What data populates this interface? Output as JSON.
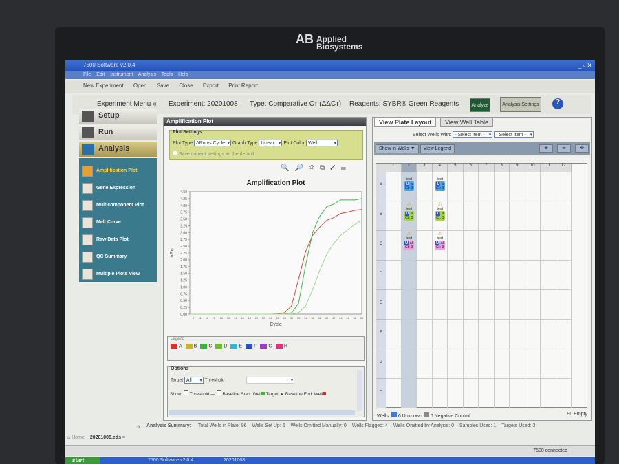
{
  "brand": {
    "logo": "AB",
    "name1": "Applied",
    "name2": "Biosystems"
  },
  "window": {
    "title": "7500 Software v2.0.4",
    "menu": [
      "File",
      "Edit",
      "Instrument",
      "Analysis",
      "Tools",
      "Help"
    ]
  },
  "toolbar": {
    "new_experiment": "New Experiment",
    "open": "Open",
    "save": "Save",
    "close": "Close",
    "export": "Export",
    "print_report": "Print Report"
  },
  "experiment": {
    "menu_title": "Experiment Menu «",
    "experiment": "Experiment: 20201008",
    "type": "Type: Comparative Cт (ΔΔCт)",
    "reagents": "Reagents: SYBR® Green Reagents",
    "analyze": "Analyze",
    "analysis_settings": "Analysis Settings",
    "help": "?"
  },
  "sidebar": {
    "stages": [
      "Setup",
      "Run",
      "Analysis"
    ],
    "items": [
      "Amplification Plot",
      "Gene Expression",
      "Multicomponent Plot",
      "Melt Curve",
      "Raw Data Plot",
      "QC Summary",
      "Multiple Plots View"
    ],
    "collapse": "«"
  },
  "amp": {
    "title": "Amplification Plot",
    "settings_tab": "Plot Settings",
    "plot_type_label": "Plot Type",
    "plot_type": "ΔRn vs Cycle",
    "graph_type_label": "Graph Type",
    "graph_type": "Linear",
    "plot_color_label": "Plot Color",
    "plot_color": "Well",
    "save_default": "Save current settings as the default",
    "legend_title": "Legend",
    "legend": [
      {
        "label": "A",
        "color": "#d9302a"
      },
      {
        "label": "B",
        "color": "#c8b52a"
      },
      {
        "label": "C",
        "color": "#36b53a"
      },
      {
        "label": "D",
        "color": "#6bbf2a"
      },
      {
        "label": "E",
        "color": "#33b6d6"
      },
      {
        "label": "F",
        "color": "#2a4fd0"
      },
      {
        "label": "G",
        "color": "#9a3ad0"
      },
      {
        "label": "H",
        "color": "#e0307a"
      }
    ],
    "options_tab": "Options",
    "target_label": "Target",
    "target": "All",
    "threshold_label": "Threshold",
    "show_label": "Show:",
    "show_threshold": "Threshold",
    "baseline_start": "Baseline Start: Well",
    "target_marker": "Target",
    "baseline_end": "Baseline End: Well"
  },
  "chart_data": {
    "type": "line",
    "title": "Amplification Plot",
    "xlabel": "Cycle",
    "ylabel": "ΔRn",
    "xlim": [
      1,
      50
    ],
    "ylim": [
      0,
      4.5
    ],
    "yticks": [
      "0.00",
      "0.25",
      "0.50",
      "0.75",
      "1.00",
      "1.25",
      "1.50",
      "1.75",
      "2.00",
      "2.25",
      "2.50",
      "2.75",
      "3.00",
      "3.25",
      "3.50",
      "3.75",
      "4.00",
      "4.25",
      "4.50"
    ],
    "x": [
      2,
      4,
      6,
      8,
      10,
      12,
      14,
      16,
      18,
      20,
      22,
      24,
      26,
      28,
      30,
      32,
      34,
      36,
      38,
      40,
      42,
      44,
      46,
      48,
      50
    ],
    "series": [
      {
        "name": "A",
        "color": "#e0403a",
        "values": [
          0,
          0,
          0,
          0,
          0,
          0,
          0,
          0,
          0,
          0,
          0,
          0,
          0.01,
          0.05,
          0.3,
          1.3,
          2.3,
          2.9,
          3.2,
          3.45,
          3.55,
          3.7,
          3.75,
          3.82,
          3.85
        ]
      },
      {
        "name": "B",
        "color": "#3fb84a",
        "values": [
          0,
          0,
          0,
          0,
          0,
          0,
          0,
          0,
          0,
          0,
          0,
          0,
          0,
          0.01,
          0.05,
          0.4,
          1.8,
          3.0,
          3.6,
          3.95,
          4.05,
          4.2,
          4.2,
          4.2,
          4.25
        ]
      },
      {
        "name": "C",
        "color": "#9fd68a",
        "values": [
          0,
          0,
          0,
          0,
          0,
          0,
          0,
          0,
          0,
          0,
          0,
          0,
          0,
          0,
          0.01,
          0.05,
          0.3,
          0.9,
          1.6,
          2.2,
          2.6,
          2.9,
          3.1,
          3.3,
          3.45
        ]
      }
    ]
  },
  "plate": {
    "tab_layout": "View Plate Layout",
    "tab_table": "View Well Table",
    "select_label": "Select Wells With:",
    "select1": "- Select Item -",
    "select2": "- Select Item -",
    "show_in_wells": "Show in Wells ▼",
    "view_legend": "View Legend",
    "columns": [
      "1",
      "2",
      "3",
      "4",
      "5",
      "6",
      "7",
      "8",
      "9",
      "10",
      "11",
      "12"
    ],
    "rows": [
      "A",
      "B",
      "C",
      "D",
      "E",
      "F",
      "G",
      "H"
    ],
    "wells": [
      {
        "row": 0,
        "col": 1,
        "sample": "test",
        "target": "a",
        "ct": "Ct: 3",
        "color": "#4aa3e8",
        "flag": false
      },
      {
        "row": 0,
        "col": 3,
        "sample": "test",
        "target": "a",
        "ct": "Ct: 3",
        "color": "#4aa3e8",
        "flag": false
      },
      {
        "row": 1,
        "col": 1,
        "sample": "test",
        "target": "a",
        "ct": "Ct: 3",
        "color": "#a6d63a",
        "flag": true
      },
      {
        "row": 1,
        "col": 3,
        "sample": "test",
        "target": "a",
        "ct": "Ct: 3",
        "color": "#a6d63a",
        "flag": true
      },
      {
        "row": 2,
        "col": 1,
        "sample": "test",
        "target": "alt",
        "ct": "Ct: 3",
        "color": "#f0a0d8",
        "flag": true
      },
      {
        "row": 2,
        "col": 3,
        "sample": "test",
        "target": "alt",
        "ct": "Ct: 3",
        "color": "#f0a0d8",
        "flag": true
      }
    ],
    "footer_wells": "Wells:",
    "unknown": "6 Unknown",
    "negative": "0 Negative Control",
    "empty": "90 Empty"
  },
  "summary": {
    "title": "Analysis Summary:",
    "items": [
      "Total Wells in Plate: 96",
      "Wells Set Up: 6",
      "Wells Omitted Manually: 0",
      "Wells Flagged: 4",
      "Wells Omitted by Analysis: 0",
      "Samples Used: 1",
      "Targets Used: 3"
    ]
  },
  "tabs": {
    "home": "Home",
    "file": "20201008.eds"
  },
  "status": {
    "connection": "7500 connected"
  },
  "taskbar": {
    "start": "start",
    "items": [
      "7500 Software v2.0.4",
      "20201008"
    ]
  }
}
